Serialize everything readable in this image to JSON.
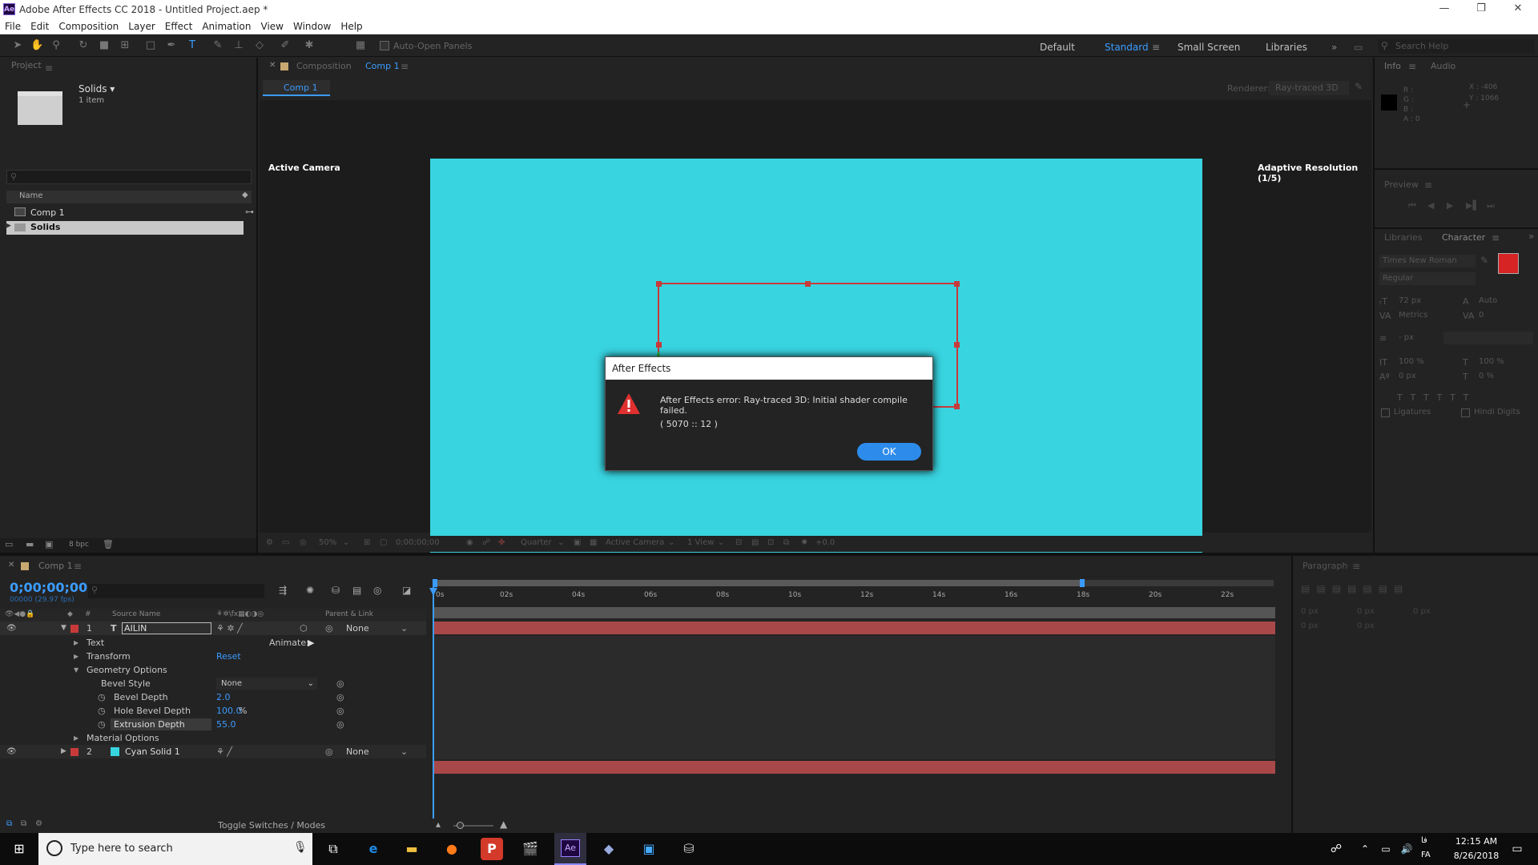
{
  "window": {
    "title": "Adobe After Effects CC 2018 - Untitled Project.aep *",
    "logo": "Ae",
    "minimize": "—",
    "restore": "❐",
    "close": "✕"
  },
  "menu": [
    "File",
    "Edit",
    "Composition",
    "Layer",
    "Effect",
    "Animation",
    "View",
    "Window",
    "Help"
  ],
  "toolbar": {
    "auto_open": "Auto-Open Panels",
    "workspaces": [
      "Default",
      "Standard",
      "Small Screen",
      "Libraries"
    ],
    "search_placeholder": "Search Help",
    "more": "»"
  },
  "project": {
    "title": "Project",
    "folder_name": "Solids ▾",
    "folder_count": "1 item",
    "col_name": "Name",
    "items": [
      "Comp 1",
      "Solids"
    ],
    "bpc": "8 bpc"
  },
  "composition": {
    "tab_label": "Composition",
    "tab_name": "Comp 1",
    "sub_tab": "Comp 1",
    "renderer_label": "Renderer:",
    "renderer_value": "Ray-traced 3D",
    "active_camera": "Active Camera",
    "adaptive": "Adaptive Resolution (1/5)",
    "bg_color": "#38d4e0",
    "footer": {
      "zoom": "50%",
      "time": "0;00;00;00",
      "quality": "Quarter",
      "camera": "Active Camera",
      "view": "1 View",
      "offset": "+0.0"
    }
  },
  "info": {
    "tabs": [
      "Info",
      "Audio"
    ],
    "r": "R :",
    "g": "G :",
    "b": "B :",
    "a": "A : 0",
    "x": "X : -406",
    "y": "Y : 1066"
  },
  "preview": {
    "title": "Preview"
  },
  "character": {
    "tabs": [
      "Libraries",
      "Character"
    ],
    "font": "Times New Roman",
    "style": "Regular",
    "size": "72 px",
    "leading": "Auto",
    "kerning": "Metrics",
    "tracking": "0",
    "stroke": "- px",
    "vscale": "100 %",
    "hscale": "100 %",
    "baseline": "0 px",
    "tsume": "0 %",
    "ligatures": "Ligatures",
    "hindi": "Hindi Digits",
    "fill_color": "#d62424"
  },
  "paragraph": {
    "title": "Paragraph",
    "v1": "0 px",
    "v2": "0 px",
    "v3": "0 px",
    "v4": "0 px",
    "v5": "0 px"
  },
  "timeline": {
    "tab": "Comp 1",
    "timecode": "0;00;00;00",
    "fps": "00000 (29.97 fps)",
    "col_source": "Source Name",
    "col_parent": "Parent & Link",
    "ruler": [
      "0s",
      "02s",
      "04s",
      "06s",
      "08s",
      "10s",
      "12s",
      "14s",
      "16s",
      "18s",
      "20s",
      "22s"
    ],
    "layer1": {
      "num": "1",
      "type": "T",
      "name": "AILIN",
      "parent": "None"
    },
    "animate": "Animate:",
    "props": {
      "text": "Text",
      "transform": "Transform",
      "reset": "Reset",
      "geometry": "Geometry Options",
      "bevel_style": "Bevel Style",
      "bevel_style_val": "None",
      "bevel_depth": "Bevel Depth",
      "bevel_depth_val": "2.0",
      "hole_bevel": "Hole Bevel Depth",
      "hole_bevel_val": "100.0",
      "hole_bevel_unit": "%",
      "extrusion": "Extrusion Depth",
      "extrusion_val": "55.0",
      "material": "Material Options"
    },
    "layer2": {
      "num": "2",
      "name": "Cyan Solid 1",
      "parent": "None"
    },
    "toggle": "Toggle Switches / Modes"
  },
  "dialog": {
    "title": "After Effects",
    "message": "After Effects error: Ray-traced 3D: Initial shader compile failed.",
    "code": "( 5070 :: 12 )",
    "ok": "OK"
  },
  "taskbar": {
    "search_placeholder": "Type here to search",
    "time": "12:15 AM",
    "date": "8/26/2018",
    "lang": "FA",
    "lang_top": "فا"
  }
}
